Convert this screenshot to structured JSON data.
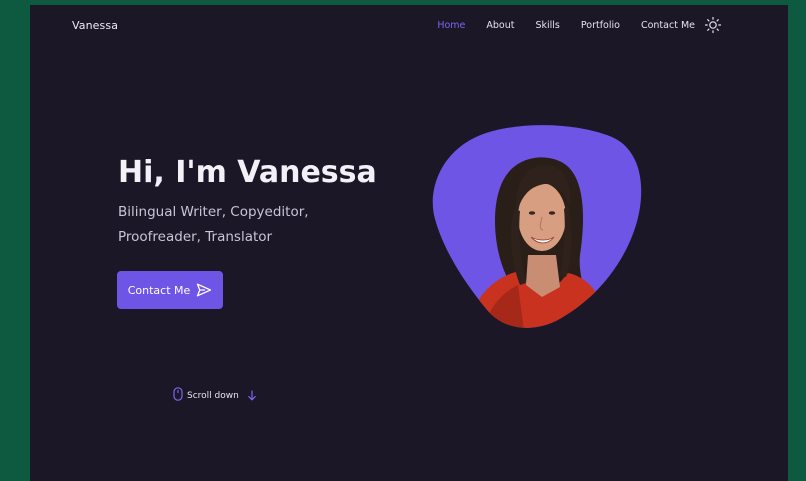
{
  "header": {
    "brand": "Vanessa",
    "nav": [
      {
        "label": "Home",
        "active": true
      },
      {
        "label": "About",
        "active": false
      },
      {
        "label": "Skills",
        "active": false
      },
      {
        "label": "Portfolio",
        "active": false
      },
      {
        "label": "Contact Me",
        "active": false
      }
    ],
    "theme_icon": "sun-icon"
  },
  "hero": {
    "title": "Hi, I'm Vanessa",
    "subtitle": "Bilingual Writer, Copyeditor, Proofreader, Translator",
    "cta_label": "Contact Me",
    "cta_icon": "send-icon",
    "photo_icon": "portrait-photo"
  },
  "scroll": {
    "label": "Scroll down",
    "icons": [
      "mouse-icon",
      "arrow-down-icon"
    ]
  },
  "colors": {
    "accent": "#6e55e6",
    "background": "#1c1727",
    "outer": "#0d5a40"
  }
}
